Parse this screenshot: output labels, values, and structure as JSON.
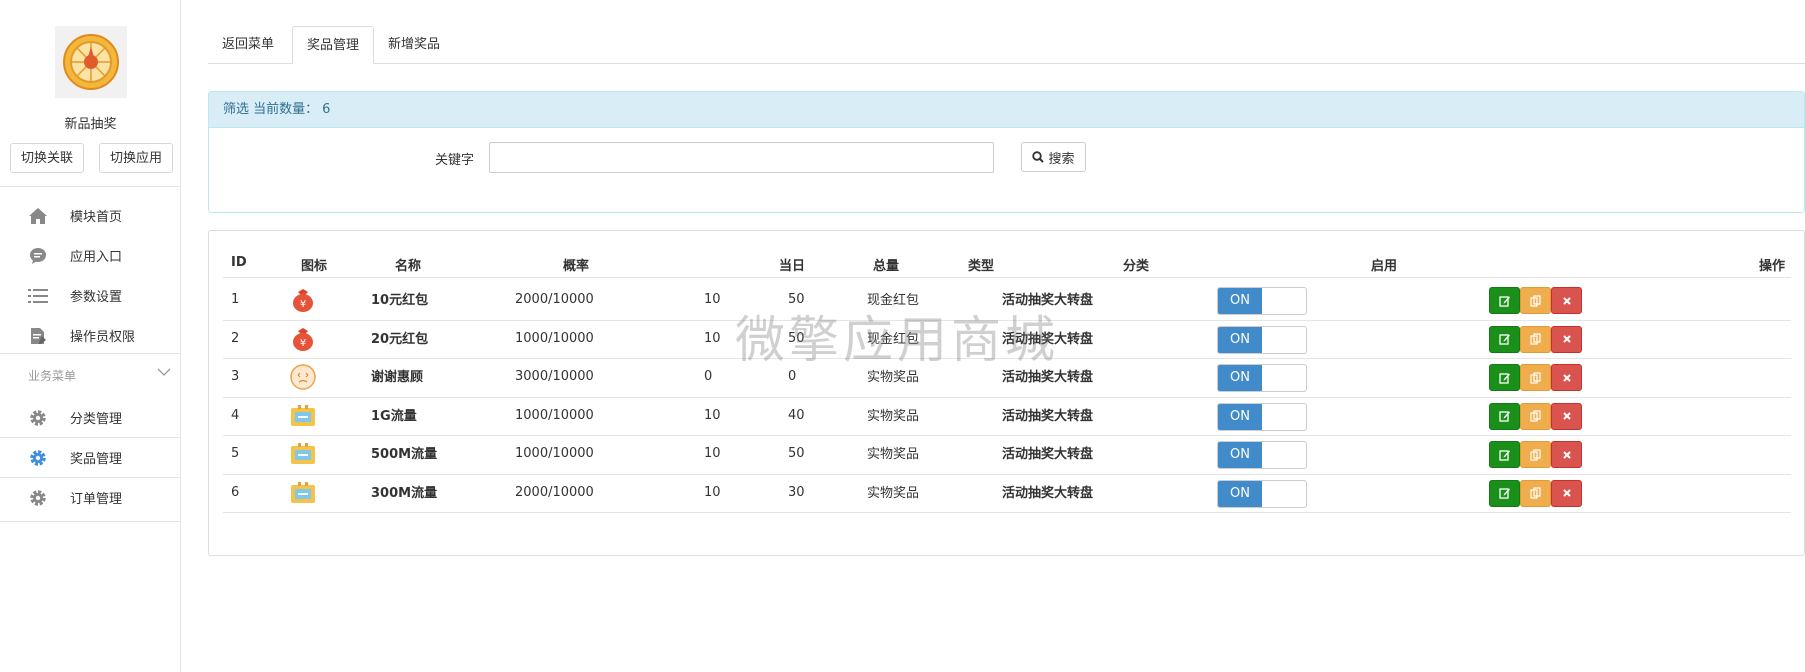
{
  "sidebar": {
    "app_name": "新品抽奖",
    "switch_link_label": "切换关联",
    "switch_app_label": "切换应用",
    "items": [
      {
        "label": "模块首页",
        "icon": "home-icon"
      },
      {
        "label": "应用入口",
        "icon": "chat-icon"
      },
      {
        "label": "参数设置",
        "icon": "list-icon"
      },
      {
        "label": "操作员权限",
        "icon": "edit-doc-icon"
      }
    ],
    "group_title": "业务菜单",
    "group_items": [
      {
        "label": "分类管理",
        "icon": "gear-icon"
      },
      {
        "label": "奖品管理",
        "icon": "gear-icon",
        "active": true
      },
      {
        "label": "订单管理",
        "icon": "gear-icon"
      }
    ]
  },
  "tabs": [
    {
      "label": "返回菜单"
    },
    {
      "label": "奖品管理",
      "active": true
    },
    {
      "label": "新增奖品"
    }
  ],
  "filter": {
    "title": "筛选 当前数量：",
    "count": "6",
    "keyword_label": "关键字",
    "keyword_value": "",
    "search_label": "搜索"
  },
  "table": {
    "headers": {
      "id": "ID",
      "icon": "图标",
      "name": "名称",
      "rate": "概率",
      "daily": "当日",
      "total": "总量",
      "type": "类型",
      "category": "分类",
      "enabled": "启用",
      "actions": "操作"
    },
    "rows": [
      {
        "id": "1",
        "icon": "red-envelope-icon",
        "name": "10元红包",
        "rate": "2000/10000",
        "daily": "10",
        "total": "50",
        "type": "现金红包",
        "category": "活动抽奖大转盘",
        "enabled": "ON"
      },
      {
        "id": "2",
        "icon": "red-envelope-icon",
        "name": "20元红包",
        "rate": "1000/10000",
        "daily": "10",
        "total": "50",
        "type": "现金红包",
        "category": "活动抽奖大转盘",
        "enabled": "ON"
      },
      {
        "id": "3",
        "icon": "smiley-icon",
        "name": "谢谢惠顾",
        "rate": "3000/10000",
        "daily": "0",
        "total": "0",
        "type": "实物奖品",
        "category": "活动抽奖大转盘",
        "enabled": "ON"
      },
      {
        "id": "4",
        "icon": "data-card-icon",
        "name": "1G流量",
        "rate": "1000/10000",
        "daily": "10",
        "total": "40",
        "type": "实物奖品",
        "category": "活动抽奖大转盘",
        "enabled": "ON"
      },
      {
        "id": "5",
        "icon": "data-card-icon",
        "name": "500M流量",
        "rate": "1000/10000",
        "daily": "10",
        "total": "50",
        "type": "实物奖品",
        "category": "活动抽奖大转盘",
        "enabled": "ON"
      },
      {
        "id": "6",
        "icon": "data-card-icon",
        "name": "300M流量",
        "rate": "2000/10000",
        "daily": "10",
        "total": "30",
        "type": "实物奖品",
        "category": "活动抽奖大转盘",
        "enabled": "ON"
      }
    ]
  },
  "watermark": "微擎应用商城",
  "colors": {
    "toggle_on": "#428bca",
    "edit_button": "#1a8f1a",
    "copy_button": "#f0ad4e",
    "delete_button": "#d9534f",
    "filter_header_bg": "#d9edf7",
    "active_nav_icon": "#3c8dde"
  }
}
